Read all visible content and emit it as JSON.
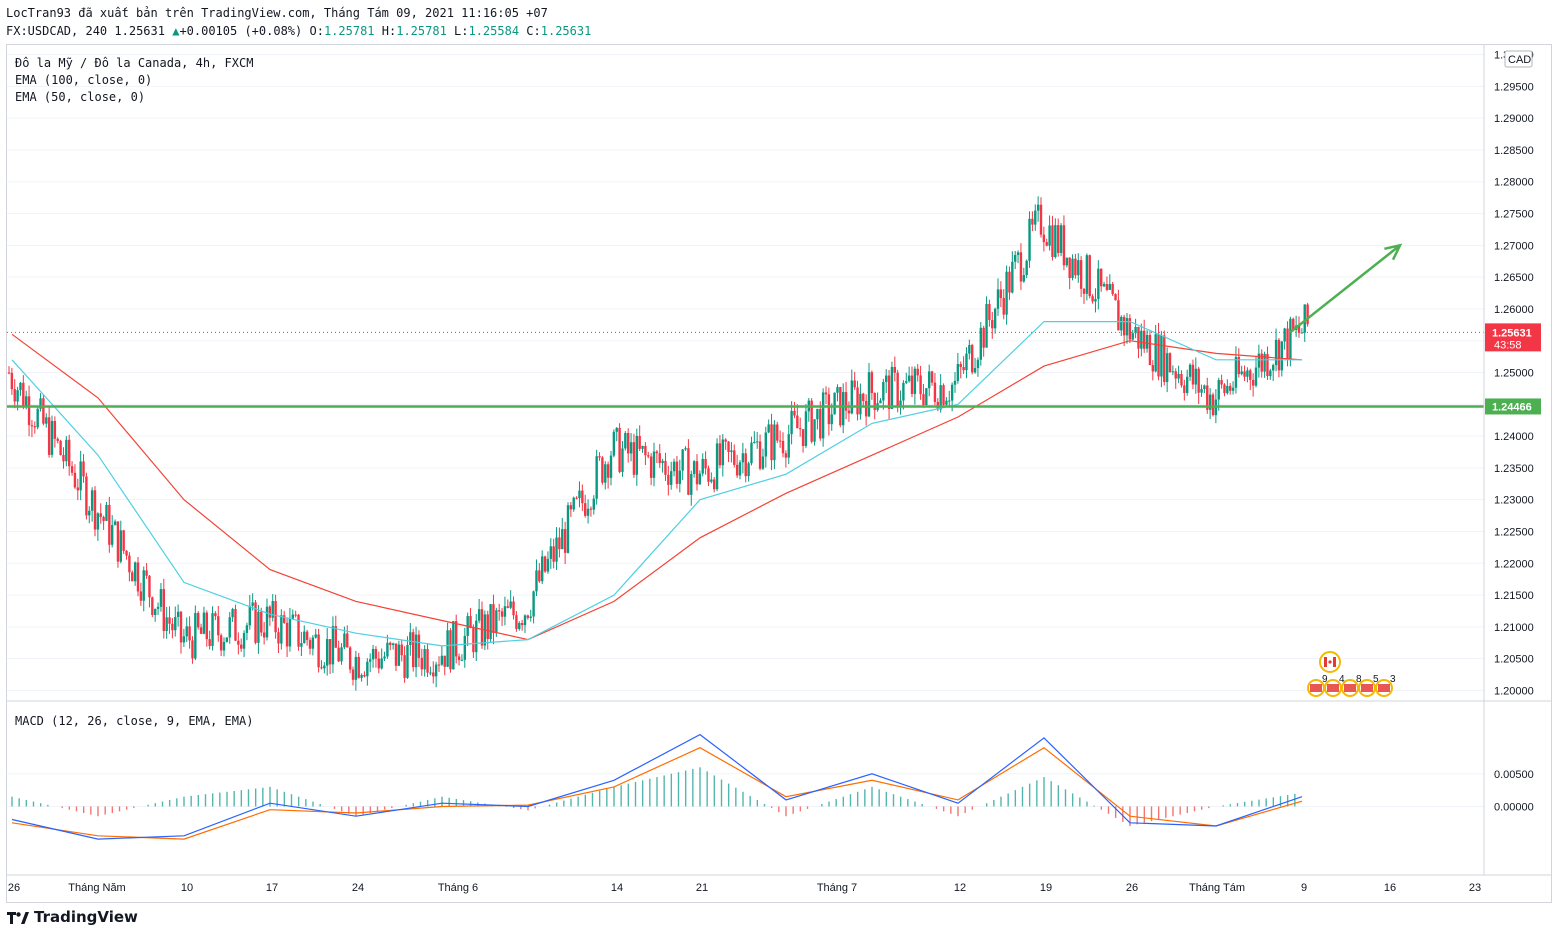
{
  "header": {
    "publish_line": "LocTran93 đã xuất bản trên TradingView.com, Tháng Tám 09, 2021 11:16:05 +07",
    "symbol_prefix": "FX:USDCAD, 240",
    "last_price": "1.25631",
    "change": "+0.00105 (+0.08%)",
    "o_label": "O:",
    "o_value": "1.25781",
    "h_label": "H:",
    "h_value": "1.25781",
    "l_label": "L:",
    "l_value": "1.25584",
    "c_label": "C:",
    "c_value": "1.25631"
  },
  "legend": {
    "instrument": "Đô la Mỹ / Đô la Canada, 4h, FXCM",
    "ema100": "EMA (100, close, 0)",
    "ema50": "EMA (50, close, 0)",
    "macd": "MACD (12, 26, close, 9, EMA, EMA)"
  },
  "axis": {
    "currency": "CAD",
    "price_ticks": [
      "1.30000",
      "1.29500",
      "1.29000",
      "1.28500",
      "1.28000",
      "1.27500",
      "1.27000",
      "1.26500",
      "1.26000",
      "1.25500",
      "1.25000",
      "1.24500",
      "1.24000",
      "1.23500",
      "1.23000",
      "1.22500",
      "1.22000",
      "1.21500",
      "1.21000",
      "1.20500",
      "1.20000"
    ],
    "macd_ticks": [
      "0.00500",
      "0.00000"
    ],
    "time_ticks": [
      "26",
      "Tháng Năm",
      "10",
      "17",
      "24",
      "Tháng 6",
      "14",
      "21",
      "Tháng 7",
      "12",
      "19",
      "26",
      "Tháng Tám",
      "9",
      "16",
      "23"
    ]
  },
  "badges": {
    "current_price": "1.25631",
    "countdown": "43:58",
    "support_price": "1.24466"
  },
  "events": {
    "numbers": [
      "9",
      "4",
      "8",
      "5",
      "3"
    ]
  },
  "colors": {
    "up": "#089981",
    "down": "#f23645",
    "ema50": "#4dd0e1",
    "ema100": "#f44336",
    "support": "#4caf50",
    "macd_line": "#2962ff",
    "signal_line": "#ff6d00"
  },
  "chart_data": {
    "type": "candlestick",
    "symbol": "USDCAD",
    "timeframe": "4h",
    "ylim": [
      1.1985,
      1.3015
    ],
    "price_series": {
      "x": [
        "Apr 26",
        "May 3",
        "May 10",
        "May 17",
        "May 24",
        "Jun 1",
        "Jun 7",
        "Jun 14",
        "Jun 21",
        "Jun 28",
        "Jul 5",
        "Jul 12",
        "Jul 19",
        "Jul 26",
        "Aug 2",
        "Aug 9"
      ],
      "close": [
        1.25,
        1.229,
        1.208,
        1.211,
        1.205,
        1.206,
        1.213,
        1.238,
        1.234,
        1.24,
        1.247,
        1.248,
        1.274,
        1.257,
        1.246,
        1.2563
      ]
    },
    "ema50": [
      1.252,
      1.237,
      1.217,
      1.212,
      1.209,
      1.207,
      1.208,
      1.215,
      1.23,
      1.234,
      1.242,
      1.245,
      1.258,
      1.258,
      1.252,
      1.252
    ],
    "ema100": [
      1.256,
      1.246,
      1.23,
      1.219,
      1.214,
      1.211,
      1.208,
      1.214,
      1.224,
      1.231,
      1.237,
      1.243,
      1.251,
      1.255,
      1.253,
      1.252
    ],
    "support_level": 1.24466,
    "current_price": 1.25631,
    "forecast_arrow": {
      "from": [
        "Aug 9",
        1.2563
      ],
      "to": [
        "Aug 18",
        1.27
      ]
    },
    "macd": {
      "ylim": [
        -0.0105,
        0.016
      ],
      "macd_line": [
        -0.002,
        -0.005,
        -0.0045,
        0.0005,
        -0.0015,
        0.0005,
        0.0,
        0.004,
        0.011,
        0.001,
        0.005,
        0.0005,
        0.0105,
        -0.0025,
        -0.003,
        0.0015
      ],
      "signal_line": [
        -0.0025,
        -0.0045,
        -0.005,
        -0.0005,
        -0.001,
        0.0,
        0.0002,
        0.003,
        0.009,
        0.0015,
        0.004,
        0.001,
        0.009,
        -0.0015,
        -0.003,
        0.0008
      ]
    }
  }
}
